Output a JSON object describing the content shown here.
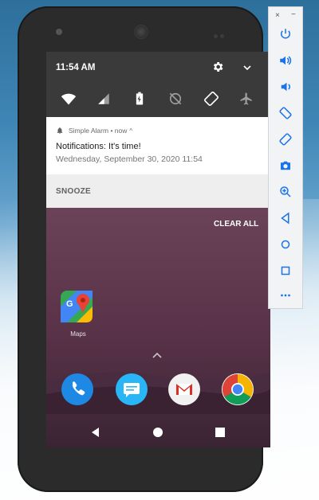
{
  "status": {
    "time": "11:54 AM"
  },
  "quick_settings": {
    "icons": [
      "settings-icon",
      "expand-icon",
      "wifi-icon",
      "cellular-icon",
      "battery-charging-icon",
      "data-saver-off-icon",
      "auto-rotate-icon",
      "airplane-mode-icon"
    ]
  },
  "notification": {
    "app": "Simple Alarm",
    "time": "now",
    "title": "Notifications: It's time!",
    "text": "Wednesday, September 30, 2020  11:54",
    "action": "SNOOZE"
  },
  "shade": {
    "clear_all": "CLEAR ALL"
  },
  "home": {
    "maps_label": "Maps",
    "dock": [
      "phone-app-icon",
      "messages-app-icon",
      "gmail-app-icon",
      "chrome-app-icon"
    ]
  },
  "toolbar": {
    "close": "×",
    "minimize": "−",
    "buttons": [
      "power-icon",
      "volume-up-icon",
      "volume-down-icon",
      "rotate-left-icon",
      "rotate-right-icon",
      "camera-icon",
      "zoom-icon",
      "back-icon",
      "home-icon",
      "overview-icon",
      "more-icon"
    ]
  },
  "colors": {
    "shade_bg": "#3a3a3a",
    "notification_bg": "#ffffff",
    "wallpaper": "#5a3f4e",
    "toolbar_icon": "#1a73e8"
  }
}
